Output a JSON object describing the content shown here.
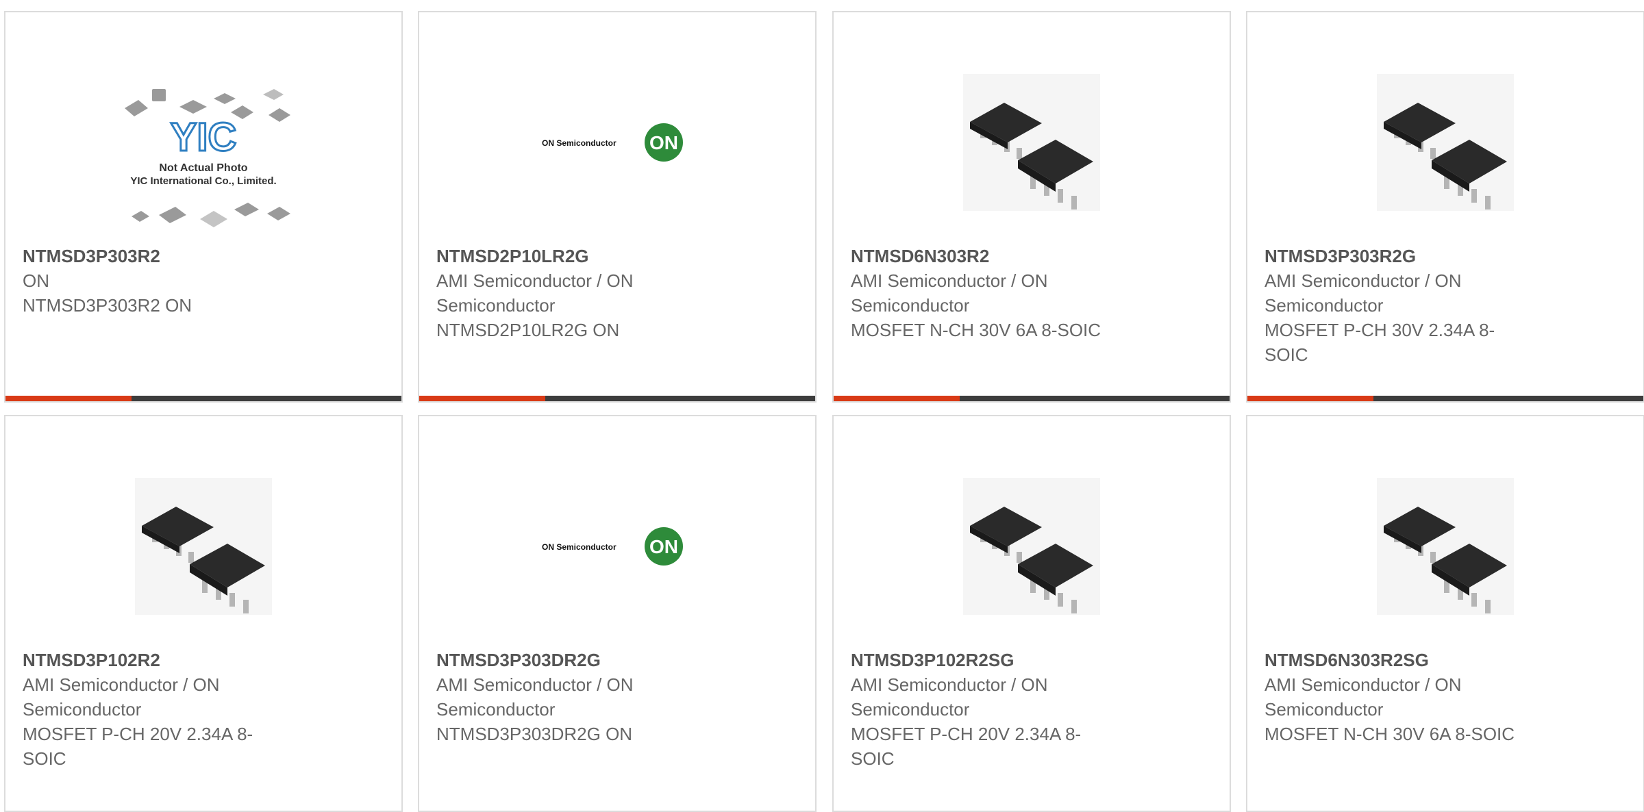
{
  "colors": {
    "accent": "#d93a16",
    "bar": "#3d3d3d",
    "border": "#dcdcdc",
    "on_logo": "#2e8b3a"
  },
  "placeholder_text": {
    "line1": "Not Actual Photo",
    "line2": "YIC International Co., Limited.",
    "logo": "YIC"
  },
  "on_logo_text": {
    "wordmark": "ON Semiconductor",
    "badge": "ON"
  },
  "products": [
    {
      "part_number": "NTMSD3P303R2",
      "manufacturer": "ON",
      "description": "NTMSD3P303R2 ON",
      "image": "placeholder"
    },
    {
      "part_number": "NTMSD2P10LR2G",
      "manufacturer": "AMI Semiconductor / ON Semiconductor",
      "description": "NTMSD2P10LR2G ON",
      "image": "on-logo"
    },
    {
      "part_number": "NTMSD6N303R2",
      "manufacturer": "AMI Semiconductor / ON Semiconductor",
      "description": "MOSFET N-CH 30V 6A 8-SOIC",
      "image": "soic-chip"
    },
    {
      "part_number": "NTMSD3P303R2G",
      "manufacturer": "AMI Semiconductor / ON Semiconductor",
      "description": "MOSFET P-CH 30V 2.34A 8-SOIC",
      "image": "soic-chip"
    },
    {
      "part_number": "NTMSD3P102R2",
      "manufacturer": "AMI Semiconductor / ON Semiconductor",
      "description": "MOSFET P-CH 20V 2.34A 8-SOIC",
      "image": "soic-chip"
    },
    {
      "part_number": "NTMSD3P303DR2G",
      "manufacturer": "AMI Semiconductor / ON Semiconductor",
      "description": "NTMSD3P303DR2G ON",
      "image": "on-logo"
    },
    {
      "part_number": "NTMSD3P102R2SG",
      "manufacturer": "AMI Semiconductor / ON Semiconductor",
      "description": "MOSFET P-CH 20V 2.34A 8-SOIC",
      "image": "soic-chip"
    },
    {
      "part_number": "NTMSD6N303R2SG",
      "manufacturer": "AMI Semiconductor / ON Semiconductor",
      "description": "MOSFET N-CH 30V 6A 8-SOIC",
      "image": "soic-chip"
    }
  ]
}
